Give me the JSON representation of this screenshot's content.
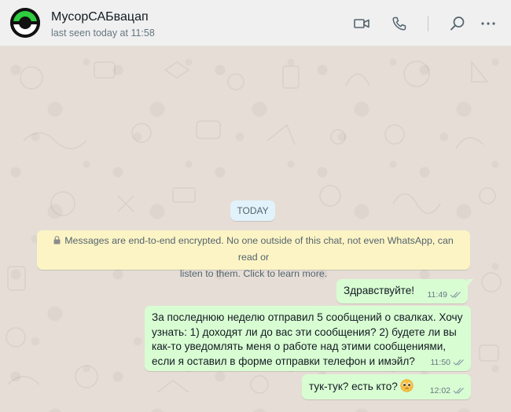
{
  "header": {
    "contact_name": "МусорСАБвацап",
    "contact_status": "last seen today at 11:58",
    "icons": [
      "video-call-icon",
      "voice-call-icon",
      "search-icon",
      "menu-icon"
    ]
  },
  "chat": {
    "date_label": "TODAY",
    "encryption_notice_line1": "Messages are end-to-end encrypted. No one outside of this chat, not even WhatsApp, can read or",
    "encryption_notice_line2": "listen to them. Click to learn more.",
    "messages": [
      {
        "lines": [
          "Здравствуйте!"
        ],
        "time": "11:49",
        "status": "read"
      },
      {
        "lines": [
          "За последнюю неделю отправил 5 сообщений о свалках. Хочу",
          "узнать:  1) доходят ли до вас эти сообщения? 2) будете ли вы",
          "как-то уведомлять меня о работе над этими сообщениями,",
          "если я оставил в форме отправки телефон и имэйл?"
        ],
        "time": "11:50",
        "status": "read"
      },
      {
        "lines": [
          "тук-тук? есть кто?"
        ],
        "emoji": "pleading-face-emoji",
        "time": "12:02",
        "status": "read"
      }
    ]
  },
  "colors": {
    "header_bg": "#f0f0f0",
    "chat_bg": "#e6ded6",
    "outgoing_bubble": "#d9fdd3",
    "date_pill": "#e1f2fb",
    "notice_bg": "#fdf4c5",
    "avatar_accent": "#00c853"
  }
}
